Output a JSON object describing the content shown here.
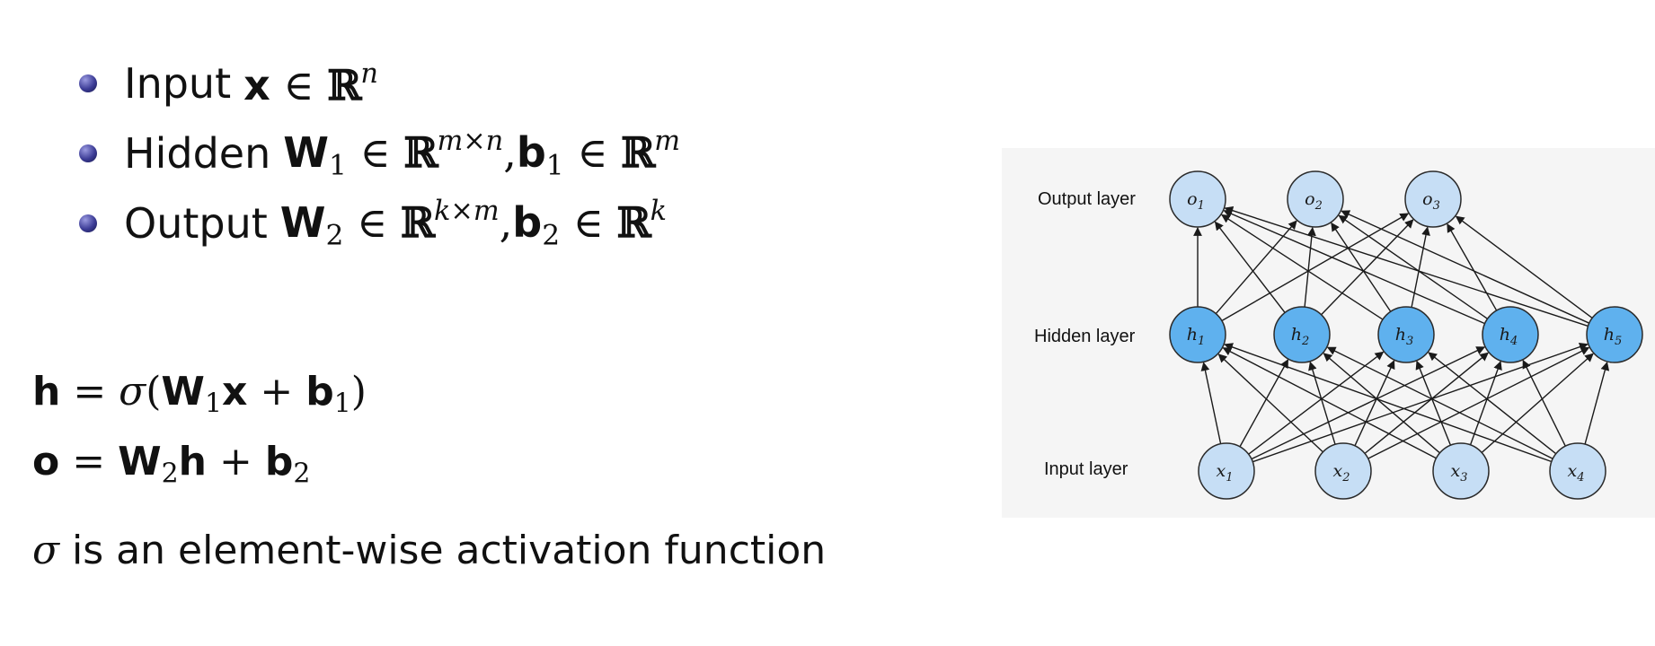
{
  "bullets": [
    {
      "label": "Input",
      "symbol": "x",
      "element_of": "∈",
      "field": "ℝ",
      "exponent": "n"
    },
    {
      "label": "Hidden",
      "weight_symbol": "W",
      "weight_index": "1",
      "element_of": "∈",
      "field": "ℝ",
      "weight_exponent": "m×n",
      "comma": ",",
      "bias_symbol": "b",
      "bias_index": "1",
      "bias_exponent": "m"
    },
    {
      "label": "Output",
      "weight_symbol": "W",
      "weight_index": "2",
      "element_of": "∈",
      "field": "ℝ",
      "weight_exponent": "k×m",
      "comma": ",",
      "bias_symbol": "b",
      "bias_index": "2",
      "bias_exponent": "k"
    }
  ],
  "equations": {
    "hidden": {
      "lhs": "h",
      "equals": " = ",
      "activation": "σ",
      "open_paren": "(",
      "weight": "W",
      "weight_index": "1",
      "input": "x",
      "plus": " + ",
      "bias": "b",
      "bias_index": "1",
      "close_paren": ")"
    },
    "output": {
      "lhs": "o",
      "equals": " = ",
      "weight": "W",
      "weight_index": "2",
      "input": "h",
      "plus": " + ",
      "bias": "b",
      "bias_index": "2"
    }
  },
  "note": {
    "symbol": "σ",
    "text": "is an element-wise activation function"
  },
  "diagram": {
    "layers": {
      "output": {
        "label": "Output layer",
        "nodes": [
          {
            "symbol": "o",
            "index": "1"
          },
          {
            "symbol": "o",
            "index": "2"
          },
          {
            "symbol": "o",
            "index": "3"
          }
        ]
      },
      "hidden": {
        "label": "Hidden layer",
        "nodes": [
          {
            "symbol": "h",
            "index": "1"
          },
          {
            "symbol": "h",
            "index": "2"
          },
          {
            "symbol": "h",
            "index": "3"
          },
          {
            "symbol": "h",
            "index": "4"
          },
          {
            "symbol": "h",
            "index": "5"
          }
        ]
      },
      "input": {
        "label": "Input layer",
        "nodes": [
          {
            "symbol": "x",
            "index": "1"
          },
          {
            "symbol": "x",
            "index": "2"
          },
          {
            "symbol": "x",
            "index": "3"
          },
          {
            "symbol": "x",
            "index": "4"
          }
        ]
      }
    },
    "connectivity": "fully-connected",
    "colors": {
      "light_node": "#c6def5",
      "hidden_node": "#5fb1ee",
      "node_stroke": "#2a2a2a",
      "edge": "#1a1a1a"
    }
  }
}
